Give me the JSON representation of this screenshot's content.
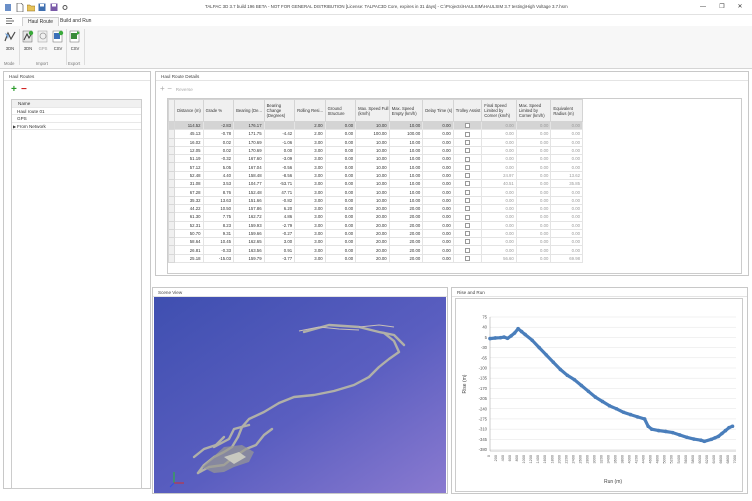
{
  "window": {
    "title": "TALPAC 3D 3.7 build 196 BETA - NOT FOR GENERAL DISTRIBUTION [License: TALPAC3D Core, expires in 31 days] - C:\\Projects\\HAULSIM\\HAULSIM 3.7 testing\\High Voltage 3.7.hsm",
    "minimize_icon": "—",
    "maximize_icon": "❐",
    "close_icon": "✕"
  },
  "tabs": [
    {
      "label": "Haul Route"
    },
    {
      "label": "Build and Run"
    }
  ],
  "ribbon": {
    "buttons": [
      {
        "label": "3DN"
      },
      {
        "label": "3DN"
      },
      {
        "label": "GPS"
      },
      {
        "label": "CSV"
      },
      {
        "label": "CSV"
      }
    ],
    "groups": [
      {
        "label": "Mode"
      },
      {
        "label": "Import"
      },
      {
        "label": "Export"
      }
    ]
  },
  "haul_routes": {
    "title": "Haul Routes",
    "column": "Name",
    "items": [
      "Haul route 01",
      "GPS",
      "From Network"
    ]
  },
  "details": {
    "title": "Haul Route Details",
    "reverse_label": "Reverse",
    "columns": [
      "Distance (m)",
      "Grade %",
      "Bearing (De...",
      "Bearing Change (Degrees)",
      "Rolling Resi...",
      "Ground Structure",
      "Max. Speed Full (km/h)",
      "Max. Speed Empty (km/h)",
      "Delay Time (s)",
      "Trolley Assist",
      "Final Speed Limited by Corner (km/h)",
      "Max. Speed Limited by Corner (km/h)",
      "Equivalent Radius (m)"
    ],
    "rows": [
      [
        "114.52",
        "-2.83",
        "176.17",
        "",
        "2.00",
        "0.00",
        "10.00",
        "10.00",
        "0.00",
        "",
        "0.00",
        "0.00",
        "0.00"
      ],
      [
        "45.13",
        "-0.78",
        "171.75",
        "-4.42",
        "2.00",
        "0.00",
        "100.00",
        "100.00",
        "0.00",
        "",
        "0.00",
        "0.00",
        "0.00"
      ],
      [
        "16.02",
        "0.02",
        "170.69",
        "-1.06",
        "3.00",
        "0.00",
        "10.00",
        "10.00",
        "0.00",
        "",
        "0.00",
        "0.00",
        "0.00"
      ],
      [
        "12.05",
        "0.02",
        "170.69",
        "0.00",
        "3.00",
        "0.00",
        "10.00",
        "10.00",
        "0.00",
        "",
        "0.00",
        "0.00",
        "0.00"
      ],
      [
        "51.19",
        "-0.32",
        "167.60",
        "-3.09",
        "3.00",
        "0.00",
        "10.00",
        "10.00",
        "0.00",
        "",
        "0.00",
        "0.00",
        "0.00"
      ],
      [
        "57.12",
        "5.05",
        "167.04",
        "-0.56",
        "3.00",
        "0.00",
        "10.00",
        "10.00",
        "0.00",
        "",
        "0.00",
        "0.00",
        "0.00"
      ],
      [
        "52.48",
        "4.40",
        "158.48",
        "-8.56",
        "3.00",
        "0.00",
        "10.00",
        "10.00",
        "0.00",
        "",
        "24.97",
        "0.00",
        "13.62"
      ],
      [
        "31.08",
        "3.53",
        "104.77",
        "-53.71",
        "3.00",
        "0.00",
        "10.00",
        "10.00",
        "0.00",
        "",
        "40.51",
        "0.00",
        "35.85"
      ],
      [
        "67.28",
        "8.76",
        "152.48",
        "47.71",
        "3.00",
        "0.00",
        "10.00",
        "10.00",
        "0.00",
        "",
        "0.00",
        "0.00",
        "0.00"
      ],
      [
        "35.32",
        "13.63",
        "151.66",
        "-0.82",
        "3.00",
        "0.00",
        "10.00",
        "10.00",
        "0.00",
        "",
        "0.00",
        "0.00",
        "0.00"
      ],
      [
        "44.22",
        "10.50",
        "157.86",
        "6.20",
        "3.00",
        "0.00",
        "20.00",
        "20.00",
        "0.00",
        "",
        "0.00",
        "0.00",
        "0.00"
      ],
      [
        "61.30",
        "7.75",
        "162.72",
        "4.86",
        "3.00",
        "0.00",
        "20.00",
        "20.00",
        "0.00",
        "",
        "0.00",
        "0.00",
        "0.00"
      ],
      [
        "52.31",
        "8.23",
        "159.93",
        "-2.79",
        "3.00",
        "0.00",
        "20.00",
        "20.00",
        "0.00",
        "",
        "0.00",
        "0.00",
        "0.00"
      ],
      [
        "50.70",
        "9.31",
        "159.66",
        "-0.27",
        "3.00",
        "0.00",
        "20.00",
        "20.00",
        "0.00",
        "",
        "0.00",
        "0.00",
        "0.00"
      ],
      [
        "58.64",
        "10.45",
        "162.65",
        "3.00",
        "3.00",
        "0.00",
        "20.00",
        "20.00",
        "0.00",
        "",
        "0.00",
        "0.00",
        "0.00"
      ],
      [
        "26.81",
        "-0.33",
        "163.56",
        "0.91",
        "3.00",
        "0.00",
        "20.00",
        "20.00",
        "0.00",
        "",
        "0.00",
        "0.00",
        "0.00"
      ],
      [
        "25.18",
        "-15.03",
        "159.79",
        "-3.77",
        "3.00",
        "0.00",
        "20.00",
        "20.00",
        "0.00",
        "",
        "56.60",
        "0.00",
        "69.98"
      ]
    ]
  },
  "scene": {
    "title": "Scene View",
    "bg_color": "#4a58b8"
  },
  "chart_data": {
    "type": "scatter",
    "title": "Rise and Run",
    "xlabel": "Run (m)",
    "ylabel": "Rise (m)",
    "color": "#4a7ebb",
    "xlim": [
      0,
      7000
    ],
    "ylim": [
      -385,
      75
    ],
    "y_ticks": [
      75,
      40,
      5,
      -30,
      -65,
      -100,
      -135,
      -170,
      -205,
      -240,
      -275,
      -310,
      -345,
      -380
    ],
    "x_ticks": [
      0,
      200,
      400,
      600,
      800,
      1000,
      1200,
      1400,
      1600,
      1800,
      2000,
      2200,
      2400,
      2600,
      2800,
      3000,
      3200,
      3400,
      3600,
      3800,
      4000,
      4200,
      4400,
      4600,
      4800,
      5000,
      5200,
      5400,
      5600,
      5800,
      6000,
      6200,
      6400,
      6600,
      6800,
      7000
    ],
    "points": [
      [
        0,
        1
      ],
      [
        150,
        3
      ],
      [
        300,
        4
      ],
      [
        400,
        6
      ],
      [
        500,
        2
      ],
      [
        600,
        10
      ],
      [
        700,
        20
      ],
      [
        800,
        35
      ],
      [
        900,
        25
      ],
      [
        1000,
        15
      ],
      [
        1200,
        -5
      ],
      [
        1400,
        -30
      ],
      [
        1600,
        -55
      ],
      [
        1800,
        -80
      ],
      [
        2000,
        -105
      ],
      [
        2200,
        -125
      ],
      [
        2400,
        -140
      ],
      [
        2600,
        -160
      ],
      [
        2800,
        -180
      ],
      [
        3000,
        -200
      ],
      [
        3200,
        -215
      ],
      [
        3400,
        -230
      ],
      [
        3600,
        -240
      ],
      [
        3800,
        -252
      ],
      [
        4000,
        -260
      ],
      [
        4200,
        -268
      ],
      [
        4400,
        -275
      ],
      [
        4500,
        -300
      ],
      [
        4600,
        -310
      ],
      [
        4800,
        -315
      ],
      [
        5000,
        -318
      ],
      [
        5200,
        -322
      ],
      [
        5400,
        -330
      ],
      [
        5600,
        -338
      ],
      [
        5800,
        -344
      ],
      [
        6000,
        -348
      ],
      [
        6100,
        -352
      ],
      [
        6300,
        -345
      ],
      [
        6400,
        -340
      ],
      [
        6500,
        -335
      ],
      [
        6600,
        -325
      ],
      [
        6700,
        -315
      ],
      [
        6800,
        -305
      ],
      [
        6900,
        -300
      ]
    ]
  }
}
